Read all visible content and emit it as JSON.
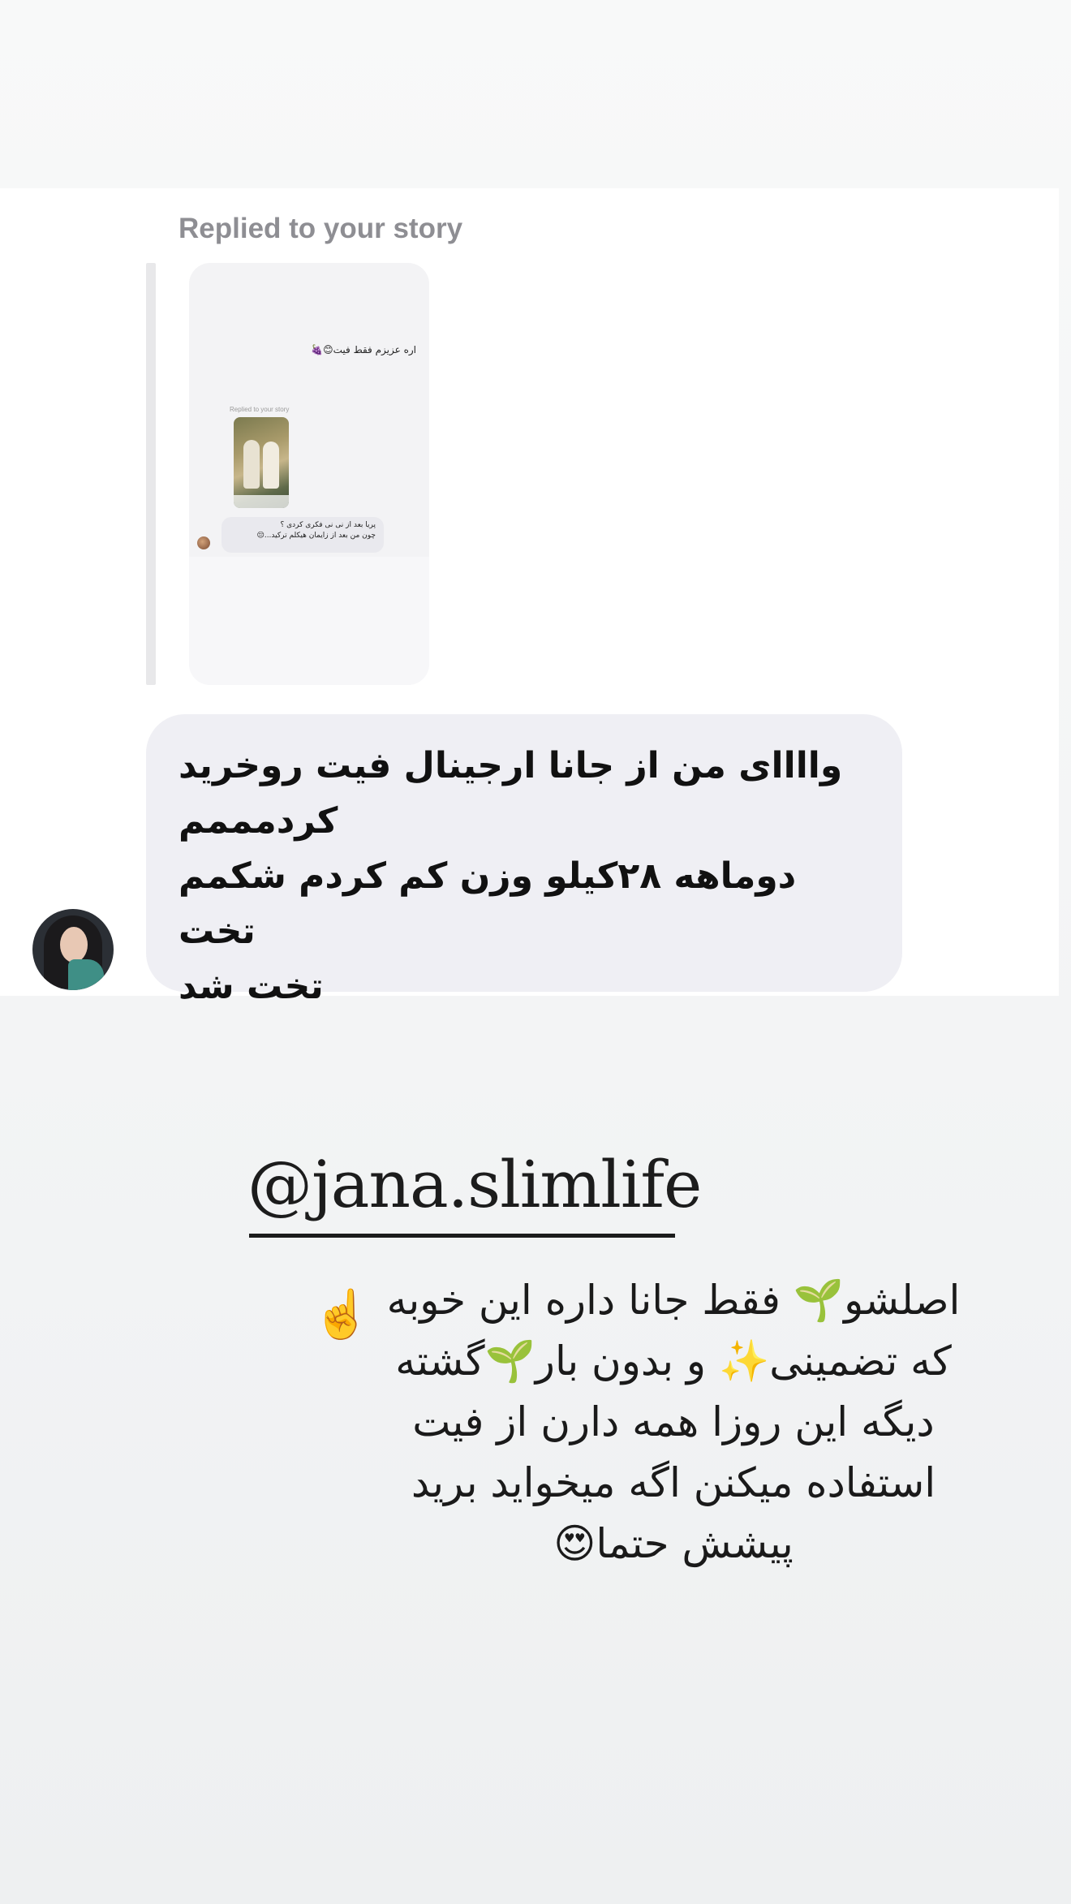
{
  "dm": {
    "replied_label": "Replied to your story",
    "story_preview": {
      "top_message": "اره عزیزم فقط فیت😊🍇",
      "inner_replied_label": "Replied to your story",
      "inner_message_line1": "پریا بعد از نی نی فکری کردی ؟",
      "inner_message_line2": "چون من بعد از زایمان هیکلم ترکید...😔"
    },
    "message_lines": [
      "واااای من از جانا ارجینال فیت روخرید",
      "کردمممم",
      "دوماهه ۲۸کیلو وزن کم کردم شکمم تخت",
      "تخت شد"
    ]
  },
  "story": {
    "handle": "@jana.slimlife",
    "caption_lines": [
      "اصلشو🌱 فقط جانا داره این خوبه",
      "که تضمینی✨ و بدون بار🌱گشته",
      "دیگه این روزا همه دارن از فیت",
      "استفاده میکنن اگه میخواید برید",
      "پیشش حتما😍"
    ],
    "pointing_emoji": "☝️"
  }
}
